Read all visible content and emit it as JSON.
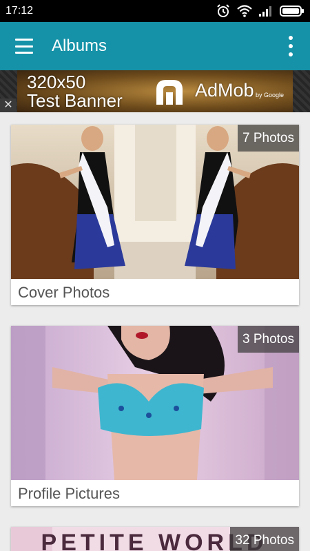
{
  "status_bar": {
    "time": "17:12",
    "icons": [
      "alarm-icon",
      "wifi-icon",
      "signal-icon",
      "battery-icon"
    ]
  },
  "app_bar": {
    "title": "Albums",
    "background": "#1592a8",
    "icons": [
      "menu-icon",
      "overflow-menu-icon"
    ]
  },
  "ad": {
    "line1": "320x50",
    "line2": "Test Banner",
    "brand": "AdMob",
    "by": "by Google",
    "close": "✕"
  },
  "albums": [
    {
      "title": "Cover Photos",
      "count": "7 Photos"
    },
    {
      "title": "Profile Pictures",
      "count": "3 Photos"
    },
    {
      "title": "",
      "count": "32 Photos",
      "image_text": "PETITE WORLD"
    }
  ]
}
